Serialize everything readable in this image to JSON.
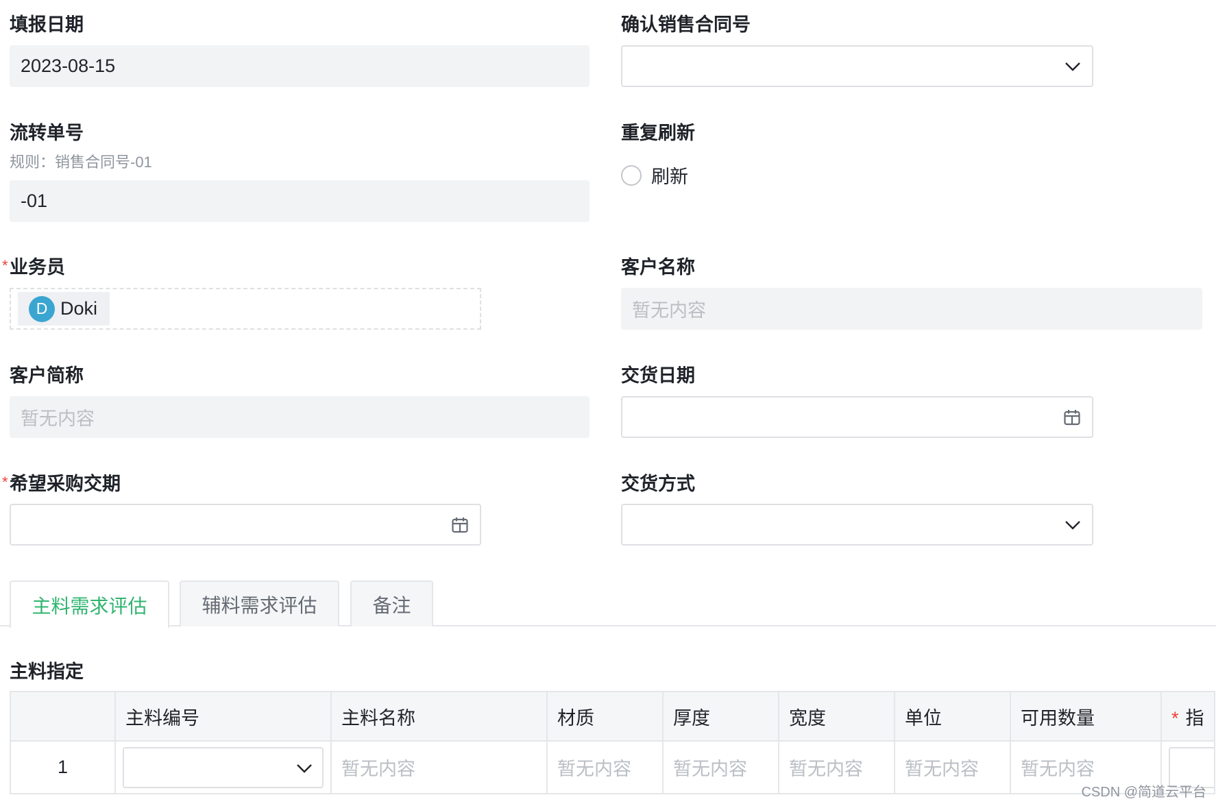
{
  "form": {
    "fill_date": {
      "label": "填报日期",
      "value": "2023-08-15"
    },
    "confirm_contract": {
      "label": "确认销售合同号",
      "value": ""
    },
    "flow_no": {
      "label": "流转单号",
      "hint": "规则：销售合同号-01",
      "value": "-01"
    },
    "refresh": {
      "label": "重复刷新",
      "option": "刷新",
      "checked": false
    },
    "salesperson": {
      "label": "业务员",
      "required": true,
      "member_name": "Doki",
      "avatar_initial": "D"
    },
    "customer_name": {
      "label": "客户名称",
      "placeholder": "暂无内容"
    },
    "customer_short": {
      "label": "客户简称",
      "placeholder": "暂无内容"
    },
    "delivery_date": {
      "label": "交货日期",
      "value": ""
    },
    "expected_date": {
      "label": "希望采购交期",
      "required": true,
      "value": ""
    },
    "delivery_method": {
      "label": "交货方式",
      "value": ""
    },
    "required_mark": "*"
  },
  "tabs": [
    {
      "label": "主料需求评估",
      "active": true
    },
    {
      "label": "辅料需求评估",
      "active": false
    },
    {
      "label": "备注",
      "active": false
    }
  ],
  "section": {
    "title": "主料指定"
  },
  "table": {
    "columns": [
      "",
      "主料编号",
      "主料名称",
      "材质",
      "厚度",
      "宽度",
      "单位",
      "可用数量",
      "指"
    ],
    "rows": [
      {
        "index": "1",
        "placeholder": "暂无内容"
      }
    ]
  },
  "watermark": "CSDN @简道云平台",
  "colors": {
    "accent": "#2fb46f",
    "required": "#f04134",
    "avatar": "#3ba5d1"
  }
}
